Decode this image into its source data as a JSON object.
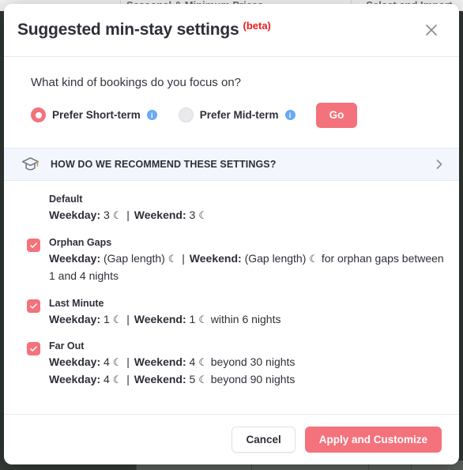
{
  "background": {
    "tab_titles": [
      "Seasonal & Minimum Prices",
      "Select and Import"
    ]
  },
  "modal": {
    "title": "Suggested min-stay settings",
    "beta_label": "(beta)",
    "close_icon": "close-icon",
    "question": "What kind of bookings do you focus on?",
    "radios": [
      {
        "label": "Prefer Short-term",
        "selected": true,
        "info_icon": "info-icon"
      },
      {
        "label": "Prefer Mid-term",
        "selected": false,
        "info_icon": "info-icon"
      }
    ],
    "go_label": "Go",
    "banner": {
      "icon": "graduation-cap-icon",
      "text": "HOW DO WE RECOMMEND THESE SETTINGS?",
      "chevron": "chevron-right-icon"
    },
    "settings": [
      {
        "name": "Default",
        "has_checkbox": false,
        "checked": false,
        "lines": [
          {
            "weekday_label": "Weekday:",
            "weekday_value": "3",
            "weekday_moon": "☾",
            "separator": "|",
            "weekend_label": "Weekend:",
            "weekend_value": "3",
            "weekend_moon": "☾",
            "suffix": ""
          }
        ]
      },
      {
        "name": "Orphan Gaps",
        "has_checkbox": true,
        "checked": true,
        "lines": [
          {
            "weekday_label": "Weekday:",
            "weekday_value": "(Gap length)",
            "weekday_moon": "☾",
            "separator": "|",
            "weekend_label": "Weekend:",
            "weekend_value": "(Gap length)",
            "weekend_moon": "☾",
            "suffix": "for orphan gaps between 1 and 4 nights"
          }
        ]
      },
      {
        "name": "Last Minute",
        "has_checkbox": true,
        "checked": true,
        "lines": [
          {
            "weekday_label": "Weekday:",
            "weekday_value": "1",
            "weekday_moon": "☾",
            "separator": "|",
            "weekend_label": "Weekend:",
            "weekend_value": "1",
            "weekend_moon": "☾",
            "suffix": "within 6 nights"
          }
        ]
      },
      {
        "name": "Far Out",
        "has_checkbox": true,
        "checked": true,
        "lines": [
          {
            "weekday_label": "Weekday:",
            "weekday_value": "4",
            "weekday_moon": "☾",
            "separator": "|",
            "weekend_label": "Weekend:",
            "weekend_value": "4",
            "weekend_moon": "☾",
            "suffix": "beyond 30 nights"
          },
          {
            "weekday_label": "Weekday:",
            "weekday_value": "4",
            "weekday_moon": "☾",
            "separator": "|",
            "weekend_label": "Weekend:",
            "weekend_value": "5",
            "weekend_moon": "☾",
            "suffix": "beyond 90 nights"
          }
        ]
      }
    ],
    "footer": {
      "cancel_label": "Cancel",
      "apply_label": "Apply and Customize"
    }
  },
  "colors": {
    "accent": "#f4727c",
    "beta_red": "#f01c1c",
    "info_blue": "#6aa9f4",
    "banner_bg": "#f3f6fd",
    "text": "#2e3038"
  }
}
